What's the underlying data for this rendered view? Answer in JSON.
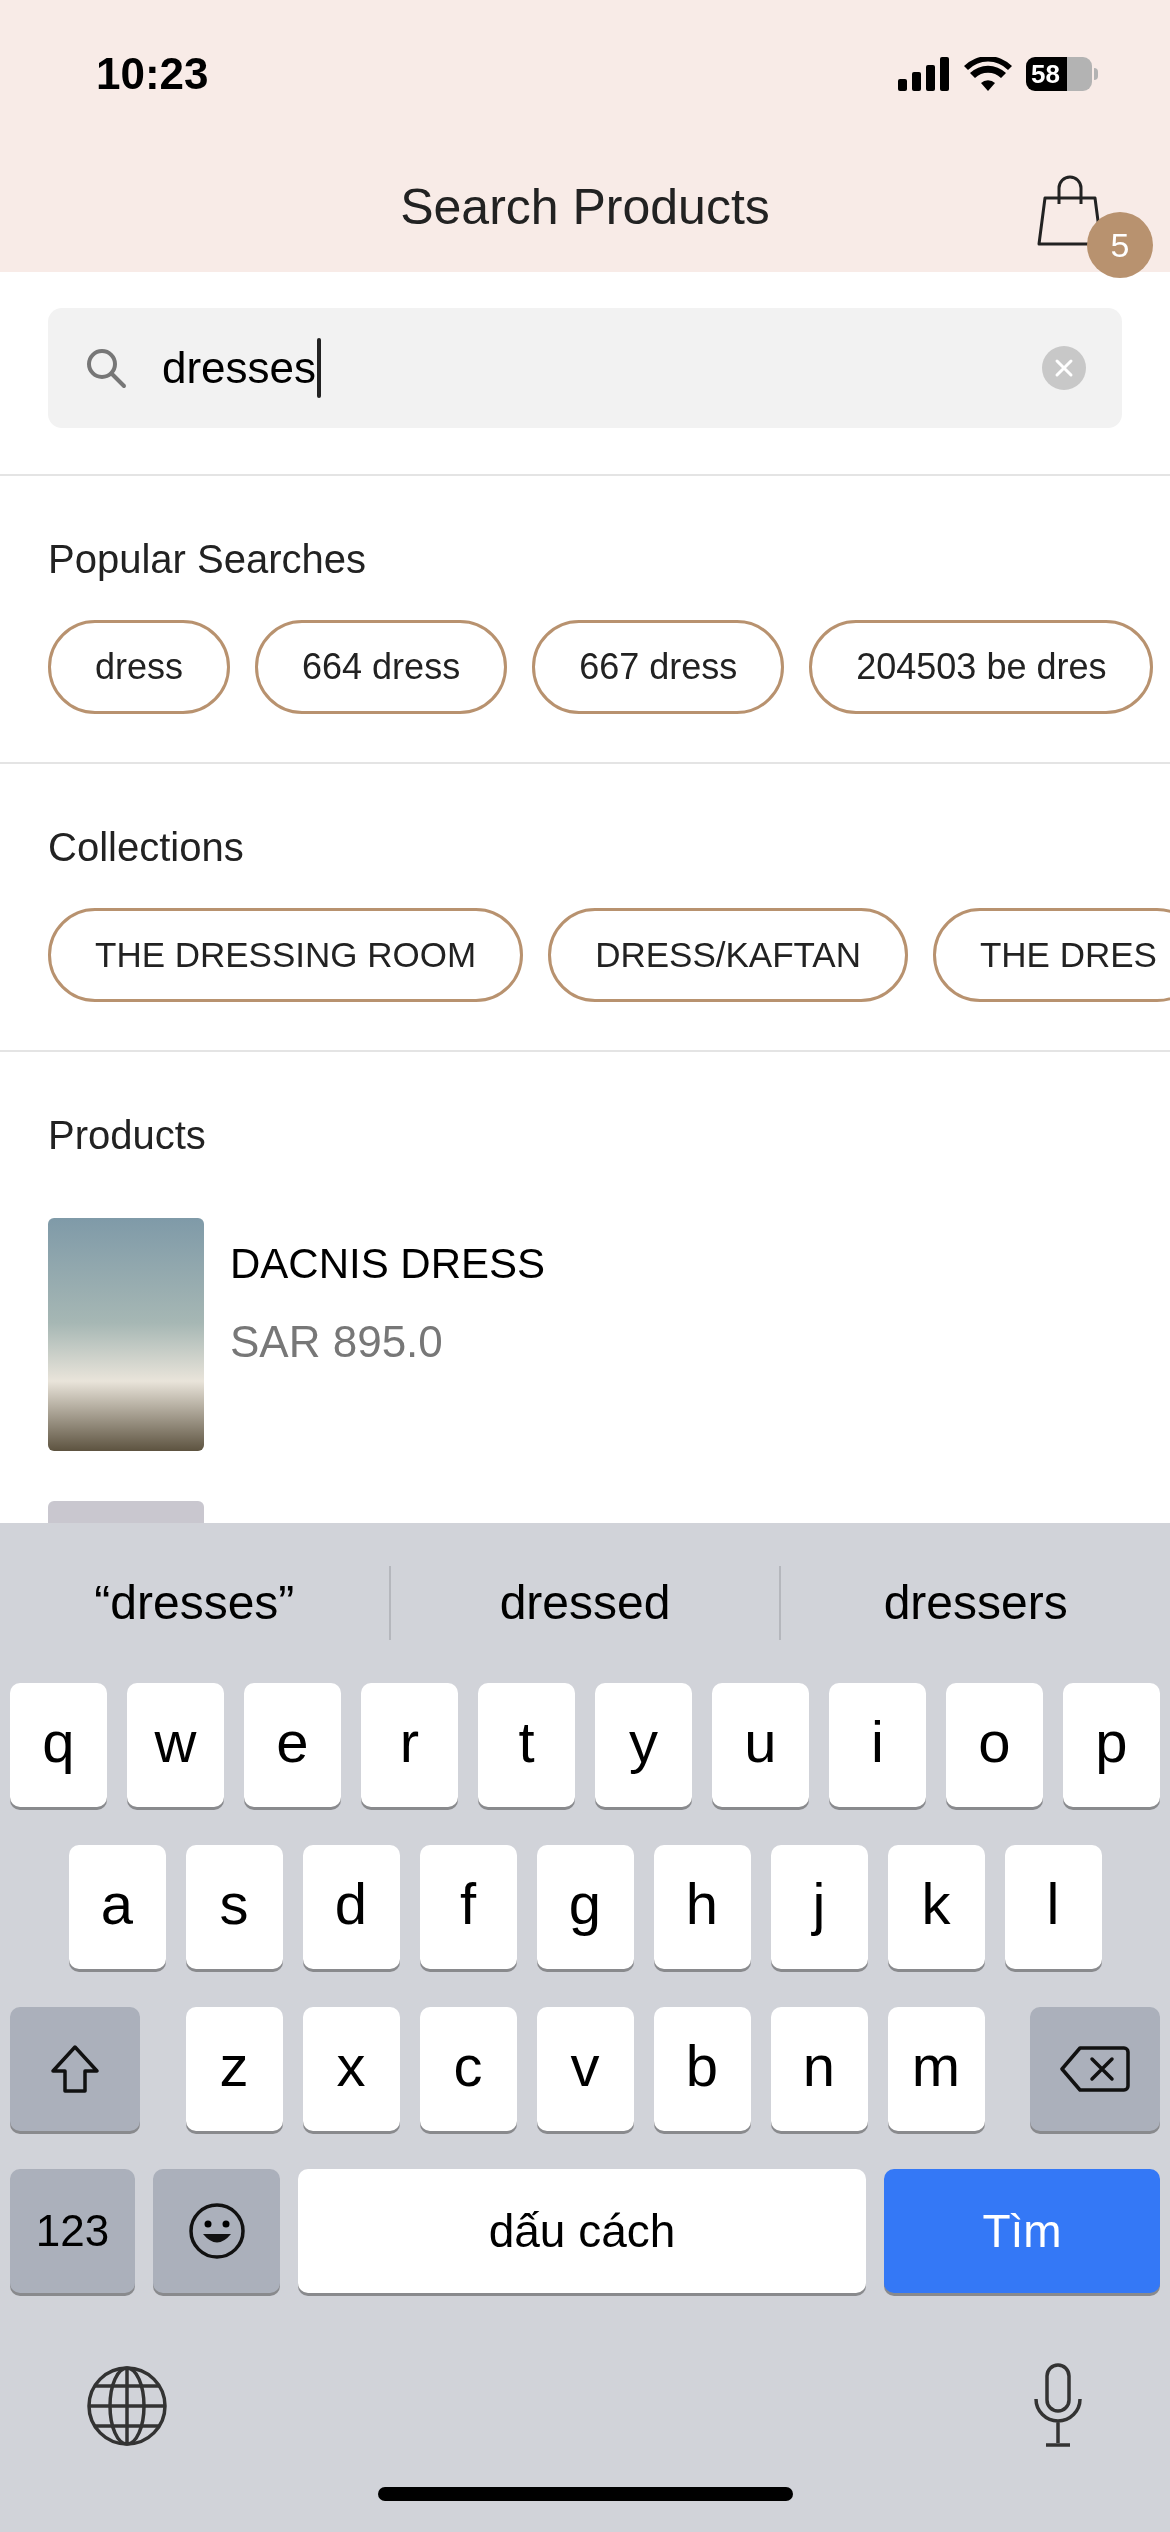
{
  "status_bar": {
    "time": "10:23",
    "battery": "58"
  },
  "header": {
    "title": "Search Products",
    "cart_count": "5"
  },
  "search": {
    "value": "dresses",
    "focused": true
  },
  "popular_searches": {
    "title": "Popular Searches",
    "chips": [
      "dress",
      "664 dress",
      "667 dress",
      "204503 be dres"
    ]
  },
  "collections": {
    "title": "Collections",
    "chips": [
      "THE DRESSING ROOM",
      "DRESS/KAFTAN",
      "THE DRES"
    ]
  },
  "products": {
    "title": "Products",
    "items": [
      {
        "name": "DACNIS DRESS",
        "price": "SAR 895.0"
      },
      {
        "image_only": true
      }
    ]
  },
  "keyboard": {
    "suggestions": [
      "“dresses”",
      "dressed",
      "dressers"
    ],
    "rows": [
      [
        "q",
        "w",
        "e",
        "r",
        "t",
        "y",
        "u",
        "i",
        "o",
        "p"
      ],
      [
        "a",
        "s",
        "d",
        "f",
        "g",
        "h",
        "j",
        "k",
        "l"
      ],
      [
        "z",
        "x",
        "c",
        "v",
        "b",
        "n",
        "m"
      ]
    ],
    "numbers_key": "123",
    "space_key": "dấu cách",
    "return_key": "Tìm"
  }
}
